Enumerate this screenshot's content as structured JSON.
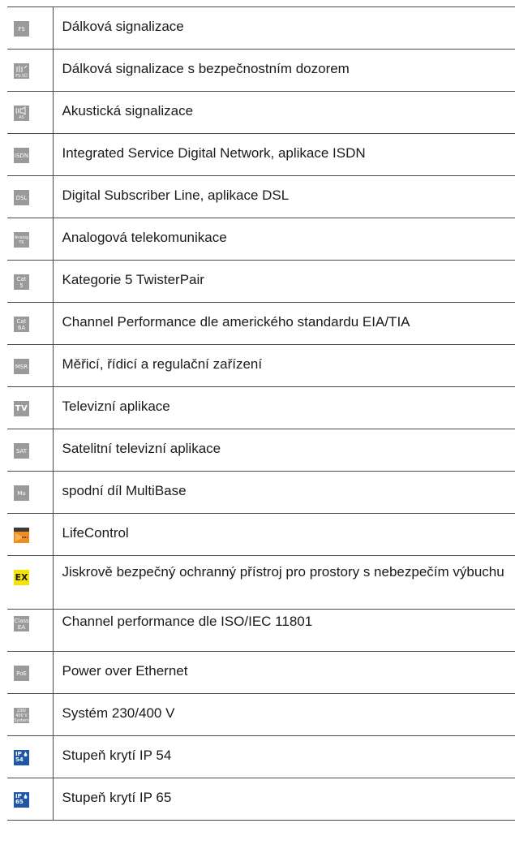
{
  "rows": [
    {
      "icon_label": "FS",
      "icon_name": "fs-icon",
      "text": "Dálková signalizace"
    },
    {
      "icon_label": "FS-SÜ",
      "icon_name": "fs-su-icon",
      "text": "Dálková signalizace s bezpečnostním dozorem"
    },
    {
      "icon_label": "AS",
      "icon_name": "speaker-as-icon",
      "text": "Akustická signalizace"
    },
    {
      "icon_label": "ISDN",
      "icon_name": "isdn-icon",
      "text": "Integrated Service Digital Network, aplikace ISDN"
    },
    {
      "icon_label": "DSL",
      "icon_name": "dsl-icon",
      "text": "Digital Subscriber Line, aplikace DSL"
    },
    {
      "icon_label_1": "Analog",
      "icon_label_2": "TK",
      "icon_name": "analog-tk-icon",
      "text": "Analogová telekomunikace"
    },
    {
      "icon_label_1": "Cat",
      "icon_label_2": "5",
      "icon_name": "cat5-icon",
      "text": "Kategorie 5 TwisterPair"
    },
    {
      "icon_label_1": "Cat",
      "icon_label_2": "6A",
      "icon_name": "cat6a-icon",
      "text": "Channel Performance dle amerického standardu EIA/TIA"
    },
    {
      "icon_label": "MSR",
      "icon_name": "msr-icon",
      "text": "Měřicí, řídicí a regulační zařízení"
    },
    {
      "icon_label": "TV",
      "icon_name": "tv-icon",
      "text": "Televizní aplikace"
    },
    {
      "icon_label": "SAT",
      "icon_name": "sat-icon",
      "text": "Satelitní televizní aplikace"
    },
    {
      "icon_label": "Mu",
      "icon_name": "multibase-icon",
      "text": "spodní díl MultiBase"
    },
    {
      "icon_label": "Life Control",
      "icon_name": "lifecontrol-icon",
      "text": "LifeControl"
    },
    {
      "icon_label": "EX",
      "icon_name": "ex-icon",
      "text": "Jiskrově bezpečný ochranný přístroj pro prostory s nebezpečím výbuchu"
    },
    {
      "icon_label_1": "Class",
      "icon_label_2": "EA",
      "icon_name": "class-ea-icon",
      "text": "Channel performance dle ISO/IEC 11801"
    },
    {
      "icon_label": "PoE",
      "icon_name": "poe-icon",
      "text": "Power over Ethernet"
    },
    {
      "icon_label_1": "230/",
      "icon_label_2": "400 V",
      "icon_label_3": "System",
      "icon_name": "system-230-400-icon",
      "text": "Systém 230/400 V"
    },
    {
      "icon_label_1": "IP",
      "icon_label_2": "54",
      "icon_name": "ip54-icon",
      "text": "Stupeň krytí IP 54"
    },
    {
      "icon_label_1": "IP",
      "icon_label_2": "65",
      "icon_name": "ip65-icon",
      "text": "Stupeň krytí IP 65"
    }
  ],
  "colors": {
    "icon_gray": "#9a9a9a",
    "ex_yellow": "#f5e400",
    "ip_blue": "#1f56a8",
    "lifecontrol_orange": "#f28c1e"
  }
}
